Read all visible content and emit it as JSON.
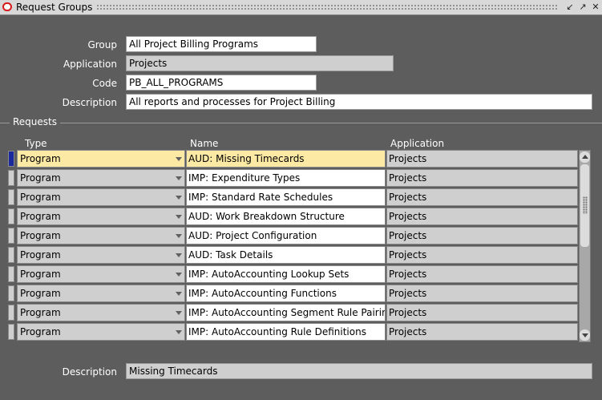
{
  "window": {
    "title": "Request Groups",
    "buttons": [
      "minimize",
      "maximize",
      "close"
    ]
  },
  "header_form": {
    "group": {
      "label": "Group",
      "value": "All Project Billing Programs"
    },
    "application": {
      "label": "Application",
      "value": "Projects"
    },
    "code": {
      "label": "Code",
      "value": "PB_ALL_PROGRAMS"
    },
    "description": {
      "label": "Description",
      "value": "All reports and processes for Project Billing"
    }
  },
  "requests": {
    "group_title": "Requests",
    "columns": [
      "Type",
      "Name",
      "Application"
    ],
    "rows": [
      {
        "type": "Program",
        "name": "AUD: Missing Timecards",
        "application": "Projects",
        "current": true
      },
      {
        "type": "Program",
        "name": "IMP: Expenditure Types",
        "application": "Projects"
      },
      {
        "type": "Program",
        "name": "IMP: Standard Rate Schedules",
        "application": "Projects"
      },
      {
        "type": "Program",
        "name": "AUD: Work Breakdown Structure",
        "application": "Projects"
      },
      {
        "type": "Program",
        "name": "AUD: Project Configuration",
        "application": "Projects"
      },
      {
        "type": "Program",
        "name": "AUD: Task Details",
        "application": "Projects"
      },
      {
        "type": "Program",
        "name": "IMP: AutoAccounting Lookup Sets",
        "application": "Projects"
      },
      {
        "type": "Program",
        "name": "IMP: AutoAccounting Functions",
        "application": "Projects"
      },
      {
        "type": "Program",
        "name": "IMP: AutoAccounting Segment Rule Pairin",
        "application": "Projects"
      },
      {
        "type": "Program",
        "name": "IMP: AutoAccounting Rule Definitions",
        "application": "Projects"
      }
    ]
  },
  "footer": {
    "description_label": "Description",
    "description_value": "Missing Timecards"
  },
  "colors": {
    "background": "#5d5d5d",
    "current_record": "#fce9a4",
    "readonly": "#cfcfcf",
    "record_indicator": "#1a2a9c"
  }
}
